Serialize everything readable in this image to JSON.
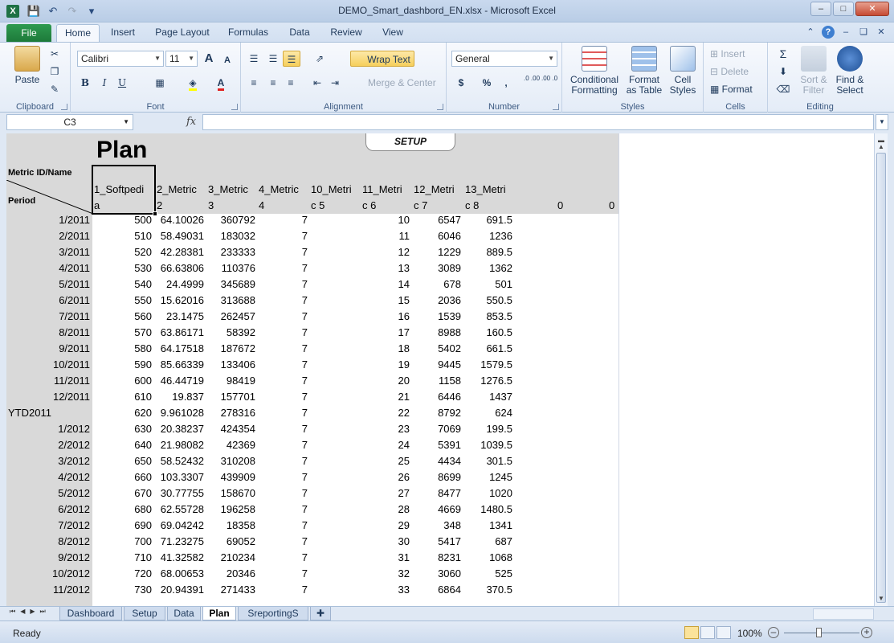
{
  "window": {
    "app_icon": "X",
    "title": "DEMO_Smart_dashbord_EN.xlsx - Microsoft Excel",
    "qat": [
      "save-icon",
      "undo-icon",
      "redo-icon",
      "customize-icon"
    ]
  },
  "ribbon_tabs": [
    "File",
    "Home",
    "Insert",
    "Page Layout",
    "Formulas",
    "Data",
    "Review",
    "View"
  ],
  "active_tab": "Home",
  "ribbon": {
    "clipboard": {
      "paste": "Paste",
      "label": "Clipboard"
    },
    "font": {
      "name": "Calibri",
      "size": "11",
      "grow": "A",
      "shrink": "A",
      "bold": "B",
      "italic": "I",
      "underline": "U",
      "label": "Font"
    },
    "alignment": {
      "wrap_text": "Wrap Text",
      "merge_center": "Merge & Center",
      "label": "Alignment"
    },
    "number": {
      "format": "General",
      "currency": "$",
      "percent": "%",
      "comma": ",",
      "inc_decimal": ".0 .00",
      "dec_decimal": ".00 .0",
      "label": "Number"
    },
    "styles": {
      "conditional": "Conditional Formatting",
      "format_table": "Format as Table",
      "cell_styles": "Cell Styles",
      "label": "Styles"
    },
    "cells": {
      "insert": "Insert",
      "delete": "Delete",
      "format": "Format",
      "label": "Cells"
    },
    "editing": {
      "sum": "Σ",
      "sort_filter": "Sort & Filter",
      "find_select": "Find & Select",
      "label": "Editing"
    }
  },
  "formula_bar": {
    "name_box": "C3",
    "fx": "fx",
    "value": ""
  },
  "sheet": {
    "title": "Plan",
    "setup_button": "SETUP",
    "metric_label": "Metric ID/Name",
    "period_label": "Period",
    "headers_line1": [
      "1_Softpedi",
      "2_Metric",
      "3_Metric",
      "4_Metric",
      "10_Metri",
      "11_Metri",
      "12_Metri",
      "13_Metri"
    ],
    "headers_line2": [
      "a",
      "2",
      "3",
      "4",
      "c 5",
      "c 6",
      "c 7",
      "c 8",
      "0",
      "0"
    ],
    "rows": [
      {
        "period": "1/2011",
        "v1": "500",
        "v2": "64.10026",
        "v3": "360792",
        "v4": "7",
        "v6": "10",
        "v7": "6547",
        "v8": "691.5"
      },
      {
        "period": "2/2011",
        "v1": "510",
        "v2": "58.49031",
        "v3": "183032",
        "v4": "7",
        "v6": "11",
        "v7": "6046",
        "v8": "1236"
      },
      {
        "period": "3/2011",
        "v1": "520",
        "v2": "42.28381",
        "v3": "233333",
        "v4": "7",
        "v6": "12",
        "v7": "1229",
        "v8": "889.5"
      },
      {
        "period": "4/2011",
        "v1": "530",
        "v2": "66.63806",
        "v3": "110376",
        "v4": "7",
        "v6": "13",
        "v7": "3089",
        "v8": "1362"
      },
      {
        "period": "5/2011",
        "v1": "540",
        "v2": "24.4999",
        "v3": "345689",
        "v4": "7",
        "v6": "14",
        "v7": "678",
        "v8": "501"
      },
      {
        "period": "6/2011",
        "v1": "550",
        "v2": "15.62016",
        "v3": "313688",
        "v4": "7",
        "v6": "15",
        "v7": "2036",
        "v8": "550.5"
      },
      {
        "period": "7/2011",
        "v1": "560",
        "v2": "23.1475",
        "v3": "262457",
        "v4": "7",
        "v6": "16",
        "v7": "1539",
        "v8": "853.5"
      },
      {
        "period": "8/2011",
        "v1": "570",
        "v2": "63.86171",
        "v3": "58392",
        "v4": "7",
        "v6": "17",
        "v7": "8988",
        "v8": "160.5"
      },
      {
        "period": "9/2011",
        "v1": "580",
        "v2": "64.17518",
        "v3": "187672",
        "v4": "7",
        "v6": "18",
        "v7": "5402",
        "v8": "661.5"
      },
      {
        "period": "10/2011",
        "v1": "590",
        "v2": "85.66339",
        "v3": "133406",
        "v4": "7",
        "v6": "19",
        "v7": "9445",
        "v8": "1579.5"
      },
      {
        "period": "11/2011",
        "v1": "600",
        "v2": "46.44719",
        "v3": "98419",
        "v4": "7",
        "v6": "20",
        "v7": "1158",
        "v8": "1276.5"
      },
      {
        "period": "12/2011",
        "v1": "610",
        "v2": "19.837",
        "v3": "157701",
        "v4": "7",
        "v6": "21",
        "v7": "6446",
        "v8": "1437"
      },
      {
        "period": "YTD2011",
        "v1": "620",
        "v2": "9.961028",
        "v3": "278316",
        "v4": "7",
        "v6": "22",
        "v7": "8792",
        "v8": "624"
      },
      {
        "period": "1/2012",
        "v1": "630",
        "v2": "20.38237",
        "v3": "424354",
        "v4": "7",
        "v6": "23",
        "v7": "7069",
        "v8": "199.5"
      },
      {
        "period": "2/2012",
        "v1": "640",
        "v2": "21.98082",
        "v3": "42369",
        "v4": "7",
        "v6": "24",
        "v7": "5391",
        "v8": "1039.5"
      },
      {
        "period": "3/2012",
        "v1": "650",
        "v2": "58.52432",
        "v3": "310208",
        "v4": "7",
        "v6": "25",
        "v7": "4434",
        "v8": "301.5"
      },
      {
        "period": "4/2012",
        "v1": "660",
        "v2": "103.3307",
        "v3": "439909",
        "v4": "7",
        "v6": "26",
        "v7": "8699",
        "v8": "1245"
      },
      {
        "period": "5/2012",
        "v1": "670",
        "v2": "30.77755",
        "v3": "158670",
        "v4": "7",
        "v6": "27",
        "v7": "8477",
        "v8": "1020"
      },
      {
        "period": "6/2012",
        "v1": "680",
        "v2": "62.55728",
        "v3": "196258",
        "v4": "7",
        "v6": "28",
        "v7": "4669",
        "v8": "1480.5"
      },
      {
        "period": "7/2012",
        "v1": "690",
        "v2": "69.04242",
        "v3": "18358",
        "v4": "7",
        "v6": "29",
        "v7": "348",
        "v8": "1341"
      },
      {
        "period": "8/2012",
        "v1": "700",
        "v2": "71.23275",
        "v3": "69052",
        "v4": "7",
        "v6": "30",
        "v7": "5417",
        "v8": "687"
      },
      {
        "period": "9/2012",
        "v1": "710",
        "v2": "41.32582",
        "v3": "210234",
        "v4": "7",
        "v6": "31",
        "v7": "8231",
        "v8": "1068"
      },
      {
        "period": "10/2012",
        "v1": "720",
        "v2": "68.00653",
        "v3": "20346",
        "v4": "7",
        "v6": "32",
        "v7": "3060",
        "v8": "525"
      },
      {
        "period": "11/2012",
        "v1": "730",
        "v2": "20.94391",
        "v3": "271433",
        "v4": "7",
        "v6": "33",
        "v7": "6864",
        "v8": "370.5"
      }
    ]
  },
  "sheet_tabs": [
    "Dashboard",
    "Setup",
    "Data",
    "Plan",
    "SreportingS"
  ],
  "active_sheet": "Plan",
  "status": {
    "ready": "Ready",
    "zoom": "100%"
  }
}
